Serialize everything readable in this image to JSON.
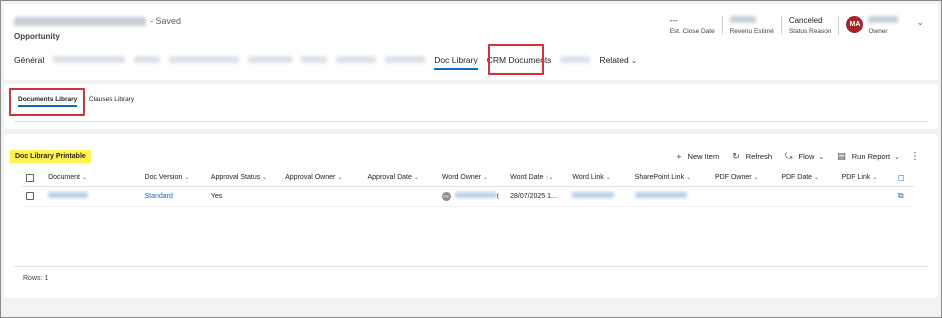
{
  "header": {
    "saved_status": "- Saved",
    "entity_type": "Opportunity",
    "fields": [
      {
        "value": "---",
        "label": "Est. Close Date"
      },
      {
        "value": "",
        "label": "Revenu Estimé"
      },
      {
        "value": "Canceled",
        "label": "Status Reason"
      }
    ],
    "owner": {
      "initials": "MA",
      "label": "Owner",
      "avatar_color": "#a4262c"
    }
  },
  "tabs": {
    "general": "Général",
    "doc_library": "Doc Library",
    "crm_documents": "CRM Documents",
    "related": "Related"
  },
  "sub_tabs": {
    "documents_library": "Documents Library",
    "clauses_library": "Clauses Library"
  },
  "grid": {
    "section_title": "Doc Library Printable",
    "toolbar": {
      "new_item": "New Item",
      "refresh": "Refresh",
      "flow": "Flow",
      "run_report": "Run Report"
    },
    "columns": [
      "Document",
      "Doc Version",
      "Approval Status",
      "Approval Owner",
      "Approval Date",
      "Word Owner",
      "Word Date",
      "Word Link",
      "SharePoint Link",
      "PDF Owner",
      "PDF Date",
      "PDF Link"
    ],
    "rows": [
      {
        "doc_version": "Standard",
        "approval_status": "Yes",
        "word_owner_initials": "OC",
        "word_owner_suffix": "t",
        "word_date": "28/07/2025 1..."
      }
    ],
    "rows_count": "Rows: 1"
  },
  "colors": {
    "accent": "#0f6cbd",
    "highlight_border": "#d13438",
    "section_highlight": "#fff44f"
  }
}
